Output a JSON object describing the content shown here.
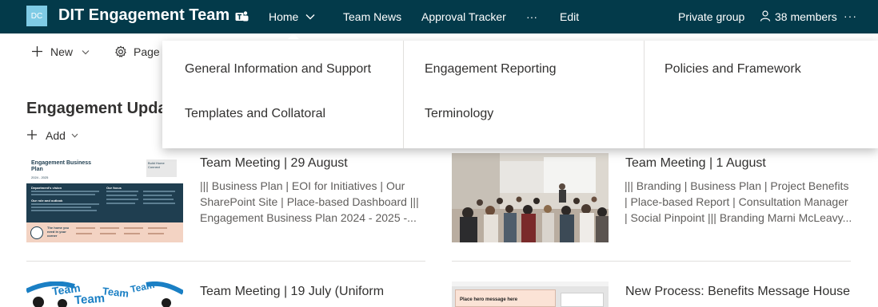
{
  "header": {
    "logo_initials": "DC",
    "site_title": "DIT Engagement Team",
    "nav": [
      "Home",
      "Team News",
      "Approval Tracker",
      "···",
      "Edit"
    ],
    "privacy": "Private group",
    "members": "38 members",
    "more": "···"
  },
  "command_bar": {
    "new_label": "New",
    "page_label": "Page d"
  },
  "mega_menu": {
    "columns": [
      [
        "General Information and Support",
        "Templates and Collatoral"
      ],
      [
        "Engagement Reporting",
        "Terminology"
      ],
      [
        "Policies and Framework"
      ]
    ]
  },
  "news": {
    "section_title": "Engagement Updat",
    "add_label": "Add",
    "items": [
      {
        "title": "Team Meeting | 29 August",
        "desc": "||| Business Plan | EOI for Initiatives | Our SharePoint Site | Place-based Dashboard ||| Engagement Business Plan 2024 - 2025 -...",
        "thumb_text": {
          "heading": "Engagement Business Plan",
          "years": "2024 - 2025",
          "vision": "Department's vision",
          "goal": "Our role and outlook",
          "focus": "Our focus",
          "tagline": "Build Home Connect",
          "footer": "The home you need in your corner"
        }
      },
      {
        "title": "Team Meeting | 1 August",
        "desc": "||| Branding | Business Plan | Project Benefits | Place-based Report | Consultation Manager | Social Pinpoint ||| Branding Marni McLeavy..."
      },
      {
        "title": "Team Meeting | 19 July (Uniform",
        "thumb_text": {
          "words": "Team"
        }
      },
      {
        "title": "New Process: Benefits Message House",
        "thumb_text": {
          "message": "Place hero message here"
        }
      }
    ]
  },
  "colors": {
    "header_bg": "#033a4a",
    "logo_bg": "#7fcbe5",
    "thumb1_navy": "#1f3e50",
    "thumb1_peach": "#f3d3c3",
    "thumb3_blue": "#1a7fc4"
  }
}
